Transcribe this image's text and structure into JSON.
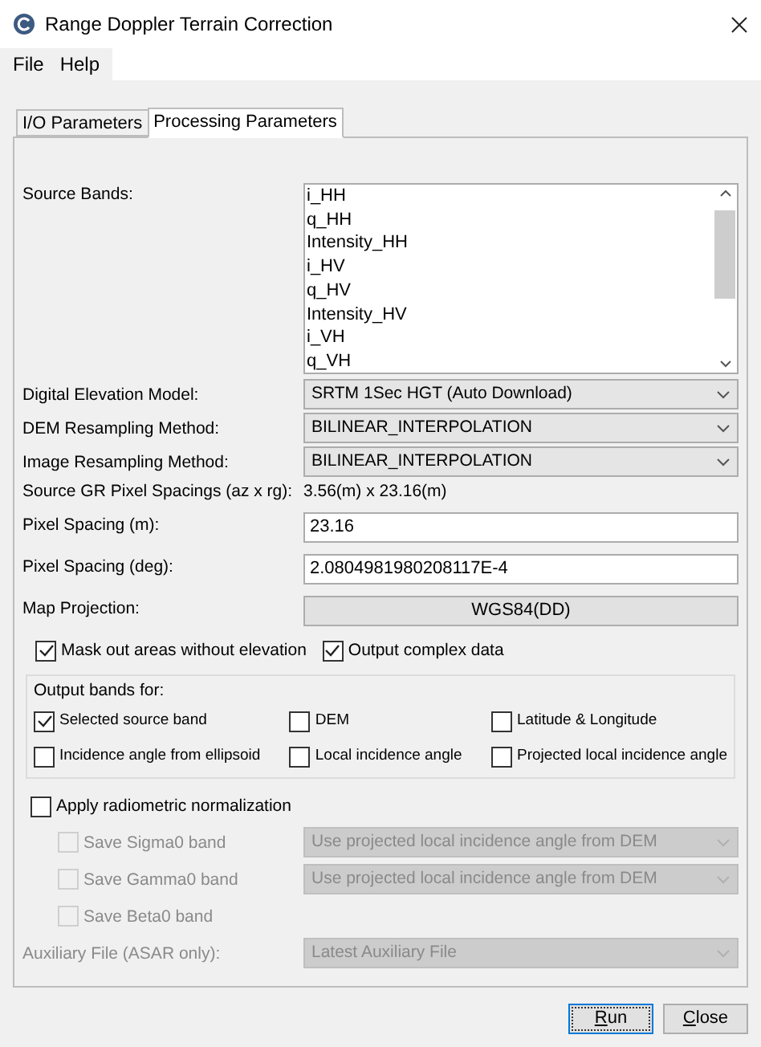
{
  "window": {
    "title": "Range Doppler Terrain Correction"
  },
  "menu": [
    "File",
    "Help"
  ],
  "tabs": [
    {
      "label": "I/O Parameters",
      "selected": false
    },
    {
      "label": "Processing Parameters",
      "selected": true
    }
  ],
  "source_bands": {
    "label": "Source Bands:",
    "items": [
      "i_HH",
      "q_HH",
      "Intensity_HH",
      "i_HV",
      "q_HV",
      "Intensity_HV",
      "i_VH",
      "q_VH"
    ]
  },
  "fields": [
    {
      "kind": "dropdown",
      "label": "Digital Elevation Model:",
      "value": "SRTM 1Sec HGT (Auto Download)"
    },
    {
      "kind": "dropdown",
      "label": "DEM Resampling Method:",
      "value": "BILINEAR_INTERPOLATION"
    },
    {
      "kind": "dropdown",
      "label": "Image Resampling Method:",
      "value": "BILINEAR_INTERPOLATION"
    },
    {
      "kind": "text",
      "label": "Source GR Pixel Spacings (az x rg):",
      "value": "3.56(m) x 23.16(m)"
    },
    {
      "kind": "input",
      "label": "Pixel Spacing (m):",
      "value": "23.16"
    },
    {
      "kind": "input",
      "label": "Pixel Spacing (deg):",
      "value": "2.0804981980208117E-4"
    },
    {
      "kind": "button",
      "label": "Map Projection:",
      "value": "WGS84(DD)"
    }
  ],
  "options": [
    {
      "label": "Mask out areas without elevation",
      "checked": true
    },
    {
      "label": "Output complex data",
      "checked": true
    }
  ],
  "output_bands": {
    "title": "Output bands for:",
    "items": [
      {
        "label": "Selected source band",
        "checked": true
      },
      {
        "label": "DEM",
        "checked": false
      },
      {
        "label": "Latitude & Longitude",
        "checked": false
      },
      {
        "label": "Incidence angle from ellipsoid",
        "checked": false
      },
      {
        "label": "Local incidence angle",
        "checked": false
      },
      {
        "label": "Projected local incidence angle",
        "checked": false
      }
    ]
  },
  "radiometric": {
    "label": "Apply radiometric normalization",
    "checked": false,
    "bands": [
      {
        "label": "Save Sigma0 band",
        "checked": false,
        "disabled": true,
        "dropdown": "Use projected local incidence angle from DEM"
      },
      {
        "label": "Save Gamma0 band",
        "checked": false,
        "disabled": true,
        "dropdown": "Use projected local incidence angle from DEM"
      },
      {
        "label": "Save Beta0 band",
        "checked": false,
        "disabled": true
      }
    ],
    "auxiliary": {
      "label": "Auxiliary File (ASAR only):",
      "value": "Latest Auxiliary File",
      "disabled": true
    }
  },
  "buttons": [
    {
      "label": "Run",
      "focused": true
    },
    {
      "label": "Close",
      "focused": false
    }
  ]
}
